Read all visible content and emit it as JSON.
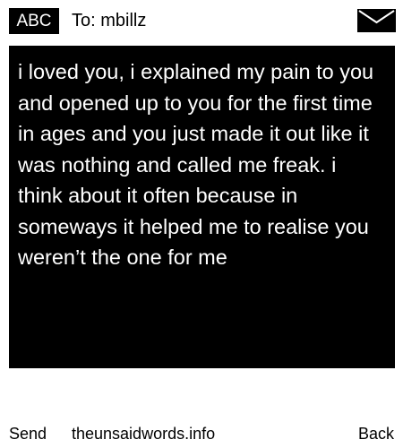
{
  "header": {
    "badge_label": "ABC",
    "to_label": "To: mbillz",
    "envelope_icon": "envelope-icon"
  },
  "message": {
    "body": "i loved you, i explained my pain to you and opened up to you for the first time in ages and you just made it out like it was nothing and called me freak. i think about it often because in someways it helped me to realise you weren’t the one for me"
  },
  "footer": {
    "send_label": "Send",
    "site_label": "theunsaidwords.info",
    "back_label": "Back"
  },
  "colors": {
    "background": "#ffffff",
    "message_background": "#000000",
    "message_text": "#ffffff"
  }
}
